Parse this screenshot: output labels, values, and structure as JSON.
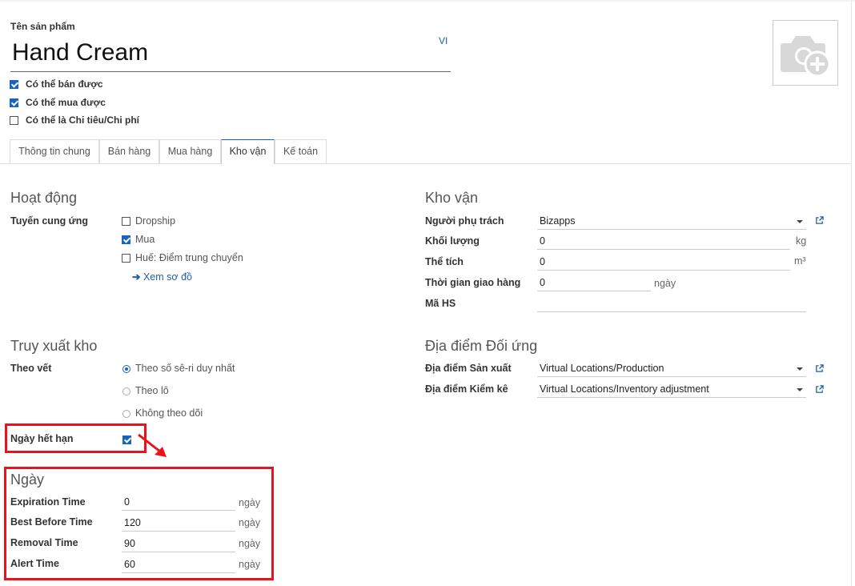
{
  "product": {
    "name_label": "Tên sản phẩm",
    "name_value": "Hand Cream",
    "lang": "VI",
    "photo_icon": "camera-plus-icon",
    "checkboxes": [
      {
        "label": "Có thể bán được",
        "checked": true
      },
      {
        "label": "Có thể mua được",
        "checked": true
      },
      {
        "label": "Có thể là Chi tiêu/Chi phí",
        "checked": false
      }
    ]
  },
  "tabs": [
    "Thông tin chung",
    "Bán hàng",
    "Mua hàng",
    "Kho vận",
    "Kế toán"
  ],
  "active_tab": "Kho vận",
  "operations": {
    "title": "Hoạt động",
    "routes_label": "Tuyến cung ứng",
    "routes": [
      {
        "label": "Dropship",
        "checked": false
      },
      {
        "label": "Mua",
        "checked": true
      },
      {
        "label": "Huế: Điểm trung chuyển",
        "checked": false
      }
    ],
    "diagram_link": "Xem sơ đồ"
  },
  "logistics": {
    "title": "Kho vận",
    "responsible_label": "Người phụ trách",
    "responsible_value": "Bizapps",
    "weight_label": "Khối lượng",
    "weight_value": "0",
    "weight_unit": "kg",
    "volume_label": "Thể tích",
    "volume_value": "0",
    "volume_unit": "m³",
    "lead_label": "Thời gian giao hàng",
    "lead_value": "0",
    "lead_unit": "ngày",
    "hs_label": "Mã HS",
    "hs_value": ""
  },
  "traceability": {
    "title": "Truy xuất kho",
    "tracking_label": "Theo vết",
    "options": [
      {
        "label": "Theo số sê-ri duy nhất",
        "selected": true
      },
      {
        "label": "Theo lô",
        "selected": false
      },
      {
        "label": "Không theo dõi",
        "selected": false
      }
    ],
    "expiry_label": "Ngày hết hạn",
    "expiry_checked": true
  },
  "counterpart": {
    "title": "Địa điểm Đối ứng",
    "production_label": "Địa điểm Sản xuất",
    "production_value": "Virtual Locations/Production",
    "inventory_label": "Địa điểm Kiểm kê",
    "inventory_value": "Virtual Locations/Inventory adjustment"
  },
  "dates": {
    "title": "Ngày",
    "rows": [
      {
        "label": "Expiration Time",
        "value": "0",
        "unit": "ngày"
      },
      {
        "label": "Best Before Time",
        "value": "120",
        "unit": "ngày"
      },
      {
        "label": "Removal Time",
        "value": "90",
        "unit": "ngày"
      },
      {
        "label": "Alert Time",
        "value": "60",
        "unit": "ngày"
      }
    ]
  },
  "annotation_color": "#e8141b",
  "accent_color": "#1565c0"
}
